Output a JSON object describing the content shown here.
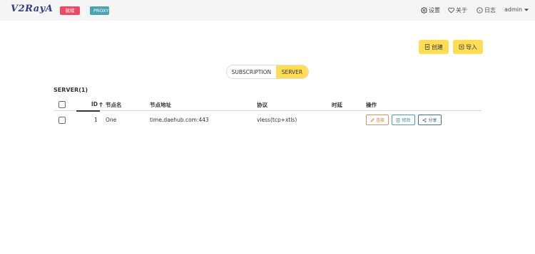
{
  "navbar": {
    "logo": "V2RayA",
    "status_tag": "就绪",
    "proxy_tag": "PROXY",
    "settings_label": "设置",
    "about_label": "关于",
    "log_label": "日志",
    "user_label": "admin"
  },
  "actions": {
    "create_label": "创建",
    "import_label": "导入"
  },
  "tabs": [
    {
      "label": "SUBSCRIPTION",
      "active": false
    },
    {
      "label": "SERVER",
      "active": true
    }
  ],
  "section": {
    "title": "SERVER(1)"
  },
  "table": {
    "columns": {
      "id": "ID",
      "name": "节点名",
      "address": "节点地址",
      "protocol": "协议",
      "latency": "时延",
      "operations": "操作"
    },
    "rows": [
      {
        "id": "1",
        "name": "One",
        "address": "time.daehub.com:443",
        "protocol": "vless(tcp+xtls)",
        "latency": "",
        "connect_label": "连接",
        "edit_label": "修改",
        "share_label": "分享"
      }
    ]
  },
  "colors": {
    "primary_yellow": "#ffdd57",
    "danger_tag": "#f14668",
    "info_tag": "#48a3b3",
    "logo": "#2d3e8f"
  },
  "icons": {
    "settings": "gear-icon",
    "about": "heart-icon",
    "log": "info-circle-icon",
    "user_dropdown": "caret-down-icon",
    "create": "file-plus-icon",
    "import": "file-import-icon",
    "sort": "arrow-up-icon",
    "connect": "pencil-icon",
    "edit": "file-edit-icon",
    "share": "share-icon"
  }
}
